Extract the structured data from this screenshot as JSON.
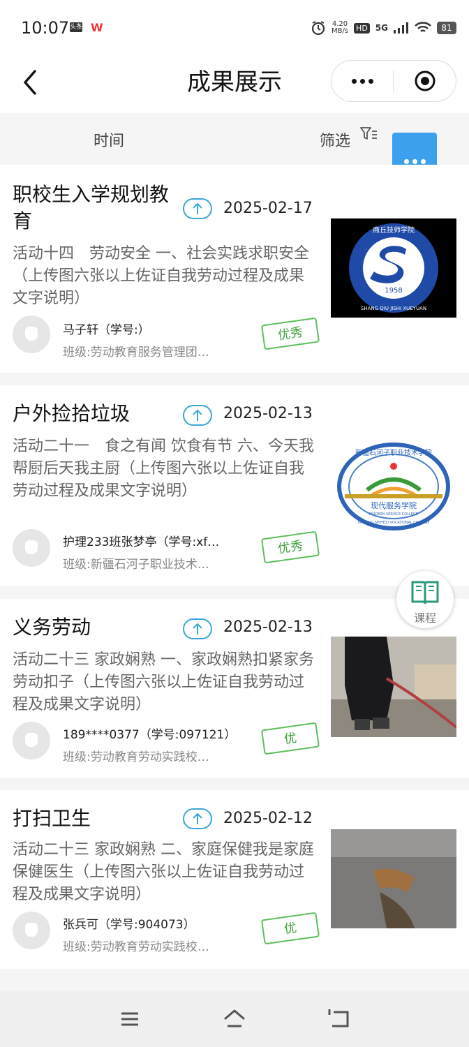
{
  "status_bar": {
    "time": "10:07",
    "app1": "头条",
    "app2": "W",
    "speed_value": "4.20",
    "speed_unit": "MB/s",
    "hd": "HD",
    "network": "5G",
    "battery": "81"
  },
  "header": {
    "title": "成果展示"
  },
  "tabs": {
    "time": "时间",
    "filter": "筛选"
  },
  "cards": [
    {
      "title": "职校生入学规划教育",
      "date": "2025-02-17",
      "desc": "活动十四　劳动安全 一、社会实践求职安全（上传图六张以上佐证自我劳动过程及成果文字说明）",
      "name": "马子轩（学号:）",
      "class": "班级:劳动教育服务管理团…",
      "badge": "优秀",
      "logo_top": "商丘技师学院",
      "logo_year": "1958",
      "logo_bottom": "SHANG QIU JISHI XUEYUAN"
    },
    {
      "title": "户外捡拾垃圾",
      "date": "2025-02-13",
      "desc": "活动二十一　食之有闻 饮食有节 六、今天我帮厨后天我主厨（上传图六张以上佐证自我劳动过程及成果文字说明）",
      "name": "护理233班张梦亭（学号:xf…",
      "class": "班级:新疆石河子职业技术…",
      "badge": "优秀",
      "logo_top": "新疆石河子职业技术学院",
      "logo_mid": "现代服务学院",
      "logo_en": "MODERN SERVICE COLLEGE",
      "logo_bottom": "XINJIANG SHIHEZI VOCATIONAL COLLEGE"
    },
    {
      "title": "义务劳动",
      "date": "2025-02-13",
      "desc": "活动二十三 家政娴熟 一、家政娴熟扣紧家务劳动扣子（上传图六张以上佐证自我劳动过程及成果文字说明）",
      "name": "189****0377（学号:097121）",
      "class": "班级:劳动教育劳动实践校…",
      "badge": "优"
    },
    {
      "title": "打扫卫生",
      "date": "2025-02-12",
      "desc": "活动二十三 家政娴熟 二、家庭保健我是家庭保健医生（上传图六张以上佐证自我劳动过程及成果文字说明）",
      "name": "张兵可（学号:904073）",
      "class": "班级:劳动教育劳动实践校…",
      "badge": "优"
    }
  ],
  "course_button": {
    "label": "课程"
  },
  "colors": {
    "accent_blue": "#3ca0ec",
    "badge_green": "#5cbf5c"
  }
}
